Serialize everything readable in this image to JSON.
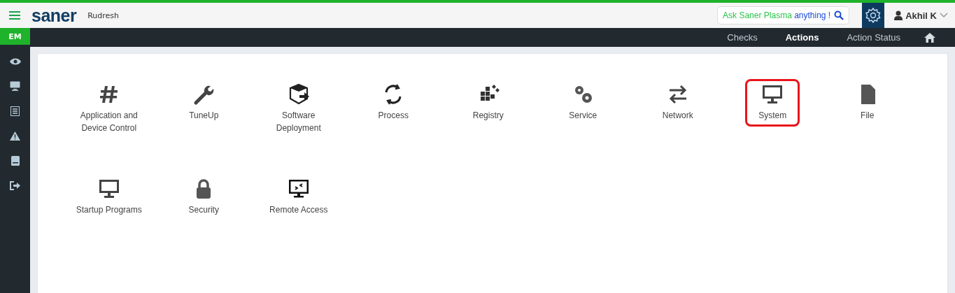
{
  "header": {
    "brand": "saner",
    "org": "Rudresh",
    "ask": {
      "lead": "Ask Saner Plasma",
      "tail": "anything !"
    },
    "user": "Akhil K"
  },
  "sidebar": {
    "badge": "EM"
  },
  "nav_tabs": [
    {
      "label": "Checks",
      "selected": false
    },
    {
      "label": "Actions",
      "selected": true
    },
    {
      "label": "Action Status",
      "selected": false
    }
  ],
  "tiles": [
    {
      "label": "Application and Device Control",
      "selected": false
    },
    {
      "label": "TuneUp",
      "selected": false
    },
    {
      "label": "Software Deployment",
      "selected": false
    },
    {
      "label": "Process",
      "selected": false
    },
    {
      "label": "Registry",
      "selected": false
    },
    {
      "label": "Service",
      "selected": false
    },
    {
      "label": "Network",
      "selected": false
    },
    {
      "label": "System",
      "selected": true
    },
    {
      "label": "File",
      "selected": false
    },
    {
      "label": "Startup Programs",
      "selected": false
    },
    {
      "label": "Security",
      "selected": false
    },
    {
      "label": "Remote Access",
      "selected": false
    }
  ]
}
